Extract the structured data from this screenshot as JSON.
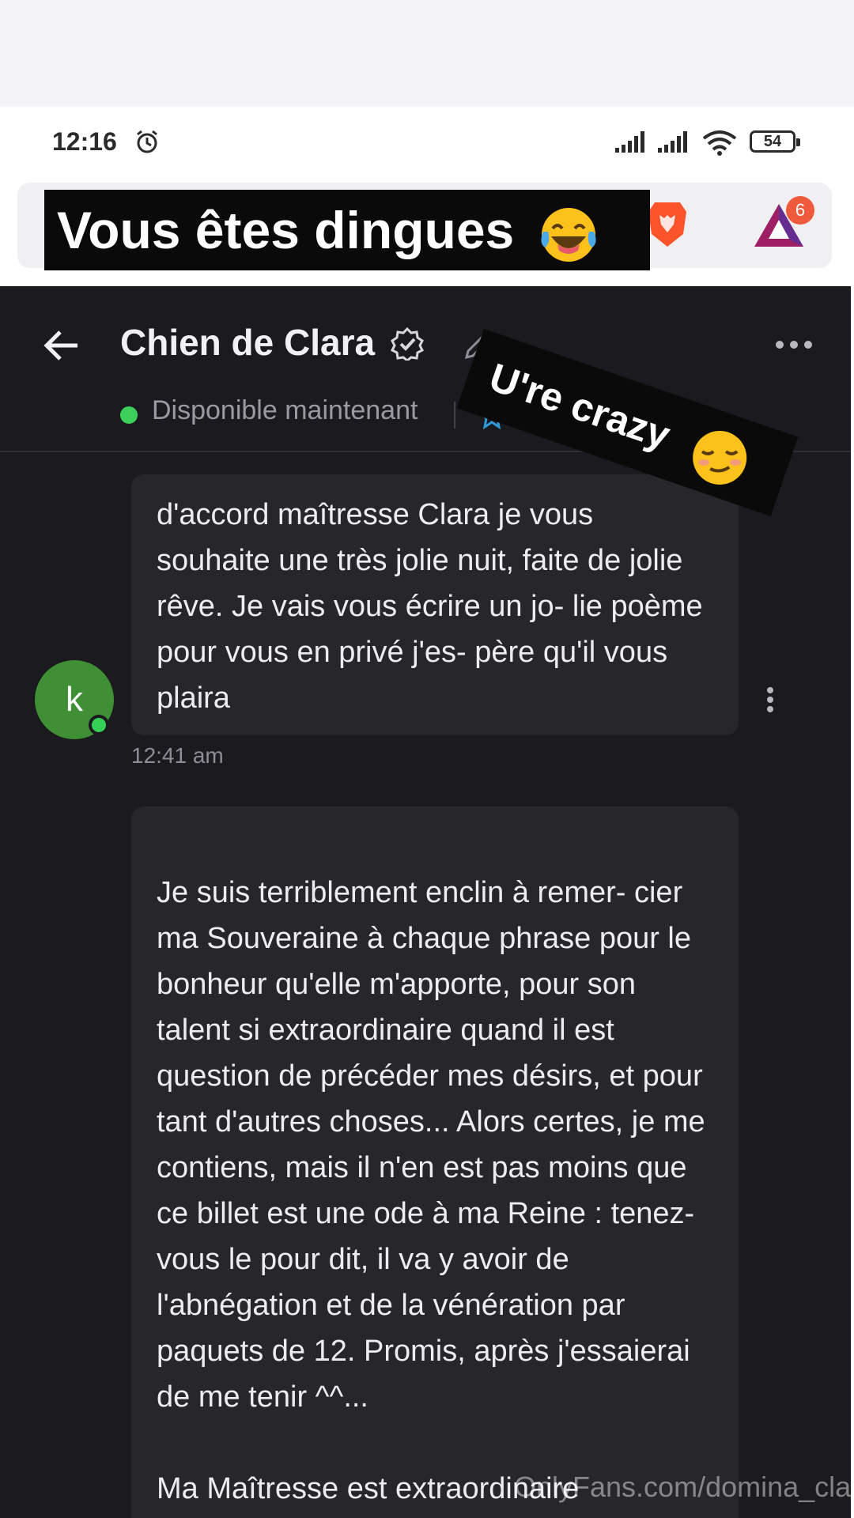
{
  "status_bar": {
    "time": "12:16",
    "battery": "54"
  },
  "browser": {
    "notification_count": "6"
  },
  "stickers": {
    "caption_one": "Vous êtes dingues",
    "caption_two": "U're crazy"
  },
  "chat": {
    "title": "Chien de Clara",
    "presence": "Disponible maintenant",
    "contact_initial": "k",
    "messages": [
      {
        "text": "d'accord maîtresse Clara je vous souhaite une très jolie nuit, faite de jolie rêve. Je vais vous écrire un jo- lie poème pour vous en privé j'es- père qu'il vous plaira",
        "time": "12:41 am"
      },
      {
        "text": "Je suis terriblement enclin à remer- cier ma Souveraine à chaque phrase pour le bonheur qu'elle m'apporte, pour son talent si extraordinaire quand il est question de précéder mes désirs, et pour tant d'autres choses... Alors certes, je me contiens, mais il n'en est pas moins que ce billet est une ode à ma Reine : tenez-vous le pour dit, il va y avoir de l'abnégation et de la vénération par paquets de 12. Promis, après j'essaierai de me tenir ^^...\n\nMa Maîtresse est extraordinaire"
      }
    ]
  },
  "watermark": "OnlyFans.com/domina_clara",
  "colors": {
    "app_background": "#1b1b1f",
    "bubble": "#26262b",
    "online_green": "#3ccf5a",
    "accent_blue": "#2f9bd8"
  }
}
